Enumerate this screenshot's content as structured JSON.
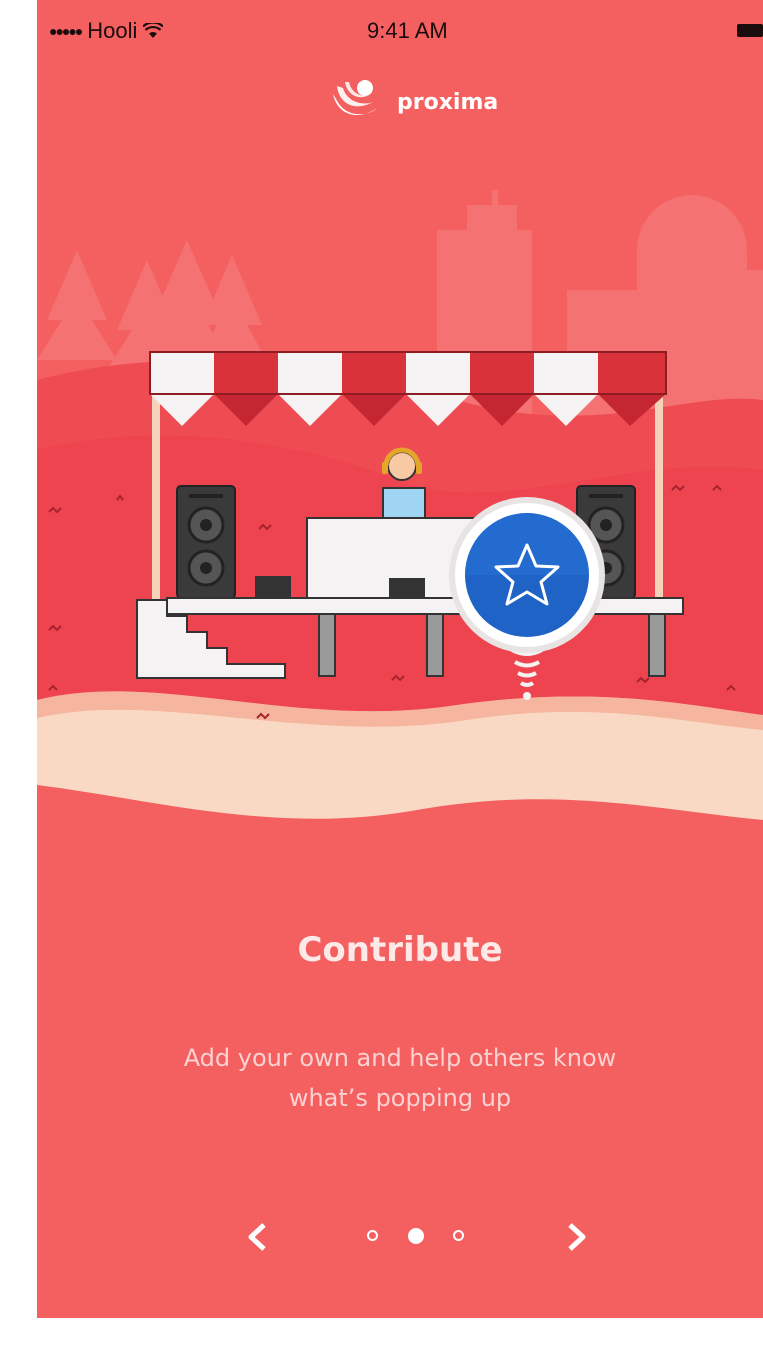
{
  "status_bar": {
    "signal": "●●●●●",
    "carrier": "Hooli",
    "time": "9:41 AM"
  },
  "brand": {
    "name": "proxima"
  },
  "onboarding": {
    "title": "Contribute",
    "description_line1": "Add your own and help others know",
    "description_line2": "what’s popping up"
  },
  "pager": {
    "prev_label": "<",
    "next_label": ">",
    "page_count": 3,
    "current_page": 2
  },
  "colors": {
    "background": "#f45f60",
    "accent_blue": "#1f63c6",
    "awning_red": "#d9323a"
  },
  "icons": [
    "wifi-icon",
    "battery-icon",
    "proxima-logo-icon",
    "star-icon",
    "chevron-left-icon",
    "chevron-right-icon"
  ]
}
